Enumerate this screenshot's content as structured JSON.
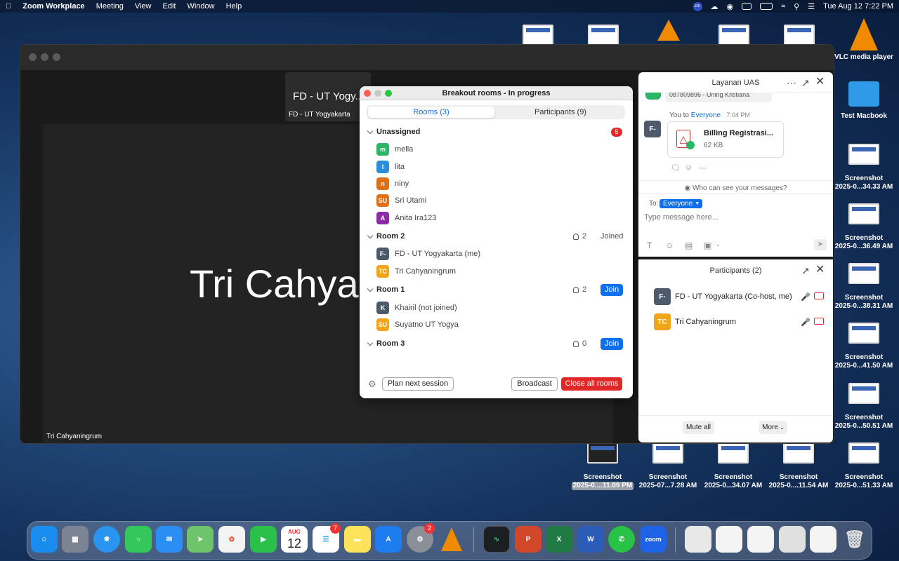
{
  "menubar": {
    "app": "Zoom Workplace",
    "items": [
      "Meeting",
      "View",
      "Edit",
      "Window",
      "Help"
    ],
    "datetime": "Tue Aug 12  7:22 PM",
    "zm_label": "zm"
  },
  "desktop": {
    "top_right": [
      {
        "l1": "VLC media player",
        "l2": ""
      },
      {
        "l1": "Test Macbook",
        "l2": ""
      },
      {
        "l1": "Screenshot",
        "l2": "2025-0...34.33 AM"
      },
      {
        "l1": "Screenshot",
        "l2": "2025-0...36.49 AM"
      },
      {
        "l1": "Screenshot",
        "l2": "2025-0...38.31 AM"
      },
      {
        "l1": "Screenshot",
        "l2": "2025-0...41.50 AM"
      },
      {
        "l1": "Screenshot",
        "l2": "2025-0...50.51 AM"
      },
      {
        "l1": "Screenshot",
        "l2": "2025-0...51.33 AM"
      }
    ],
    "bottom": [
      {
        "l1": "Screenshot",
        "l2": "2025-0....11.09 PM"
      },
      {
        "l1": "Screenshot",
        "l2": "2025-07...7.28 AM"
      },
      {
        "l1": "Screenshot",
        "l2": "2025-0...34.07 AM"
      },
      {
        "l1": "Screenshot",
        "l2": "2025-0....11.54 AM"
      }
    ]
  },
  "zoom": {
    "self_name": "FD - UT Yogy...",
    "self_label": "FD - UT Yogyakarta",
    "main_name": "Tri Cahyani",
    "main_label": "Tri Cahyaningrum"
  },
  "breakout": {
    "title": "Breakout rooms - In progress",
    "tab_rooms": "Rooms (3)",
    "tab_participants": "Participants (9)",
    "unassigned": {
      "label": "Unassigned",
      "count": "5",
      "people": [
        {
          "init": "m",
          "name": "mella",
          "color": "#2bb566"
        },
        {
          "init": "l",
          "name": "lita",
          "color": "#2a8fd6"
        },
        {
          "init": "n",
          "name": "niny",
          "color": "#e07018"
        },
        {
          "init": "SU",
          "name": "Sri Utami",
          "color": "#e07018"
        },
        {
          "init": "A",
          "name": "Anita Ira123",
          "color": "#8c2aa8"
        }
      ]
    },
    "room2": {
      "label": "Room 2",
      "count": "2",
      "status": "Joined",
      "people": [
        {
          "init": "F-",
          "name": "FD - UT Yogyakarta (me)",
          "color": "#4d5a6b"
        },
        {
          "init": "TC",
          "name": "Tri Cahyaningrum",
          "color": "#f2a517"
        }
      ]
    },
    "room1": {
      "label": "Room 1",
      "count": "2",
      "join": "Join",
      "people": [
        {
          "init": "K",
          "name": "Khairil (not joined)",
          "color": "#4d5a6b"
        },
        {
          "init": "SU",
          "name": "Suyatno UT Yogya",
          "color": "#f2a517"
        }
      ]
    },
    "room3": {
      "label": "Room 3",
      "count": "0",
      "join": "Join"
    },
    "plan": "Plan next session",
    "broadcast": "Broadcast",
    "close_all": "Close all rooms"
  },
  "chat": {
    "title": "Layanan UAS",
    "prev_snippet": "087809896 - Uning Kristiana",
    "sender_prefix": "You to ",
    "sender_target": "Everyone",
    "time": "7:04 PM",
    "avatar": "F-",
    "file_name": "Billing Registrasi...",
    "file_size": "62 KB",
    "privacy": "Who can see your messages?",
    "to_label": "To:",
    "to_value": "Everyone",
    "placeholder": "Type message here..."
  },
  "participants": {
    "title": "Participants (2)",
    "list": [
      {
        "init": "F-",
        "name": "FD - UT Yogyakarta (Co-host, me)",
        "color": "#4d5a6b"
      },
      {
        "init": "TC",
        "name": "Tri Cahyaningrum",
        "color": "#f2a517"
      }
    ],
    "mute_all": "Mute all",
    "more": "More"
  },
  "dock": {
    "calendar_month": "AUG",
    "calendar_day": "12",
    "reminders_badge": "7",
    "settings_badge": "2",
    "zoom_label": "zoom"
  }
}
